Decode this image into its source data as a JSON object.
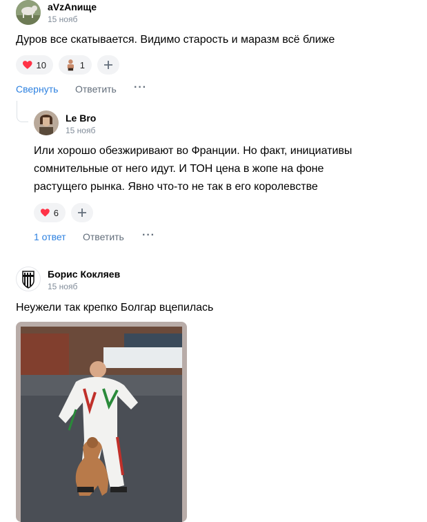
{
  "comment1": {
    "author": "aVzAnище",
    "date": "15 нояб",
    "text": "Дуров все скатывается. Видимо старость и маразм всё ближе",
    "reactions": [
      {
        "icon": "heart-icon",
        "count": "10"
      },
      {
        "icon": "sticker-person-icon",
        "count": "1"
      }
    ],
    "collapse_label": "Свернуть",
    "reply_label": "Ответить",
    "more_label": "···"
  },
  "reply1": {
    "author": "Le Bro",
    "date": "15 нояб",
    "text_lines": [
      "Или хорошо обезжиривают во Франции. Но факт, инициативы",
      "сомнительные от него идут. И ТОН цена в жопе на фоне",
      "растущего рынка. Явно что-то не так в его королевстве"
    ],
    "reactions": [
      {
        "icon": "heart-icon",
        "count": "6"
      }
    ],
    "answers_label": "1 ответ",
    "reply_label": "Ответить",
    "more_label": "···"
  },
  "comment2": {
    "author": "Борис Кокляев",
    "date": "15 нояб",
    "text": "Неужели так крепко Болгар вцепилась"
  },
  "colors": {
    "link_blue": "#2a5885",
    "heart_red": "#ff3347",
    "meta_gray": "#818c99"
  }
}
